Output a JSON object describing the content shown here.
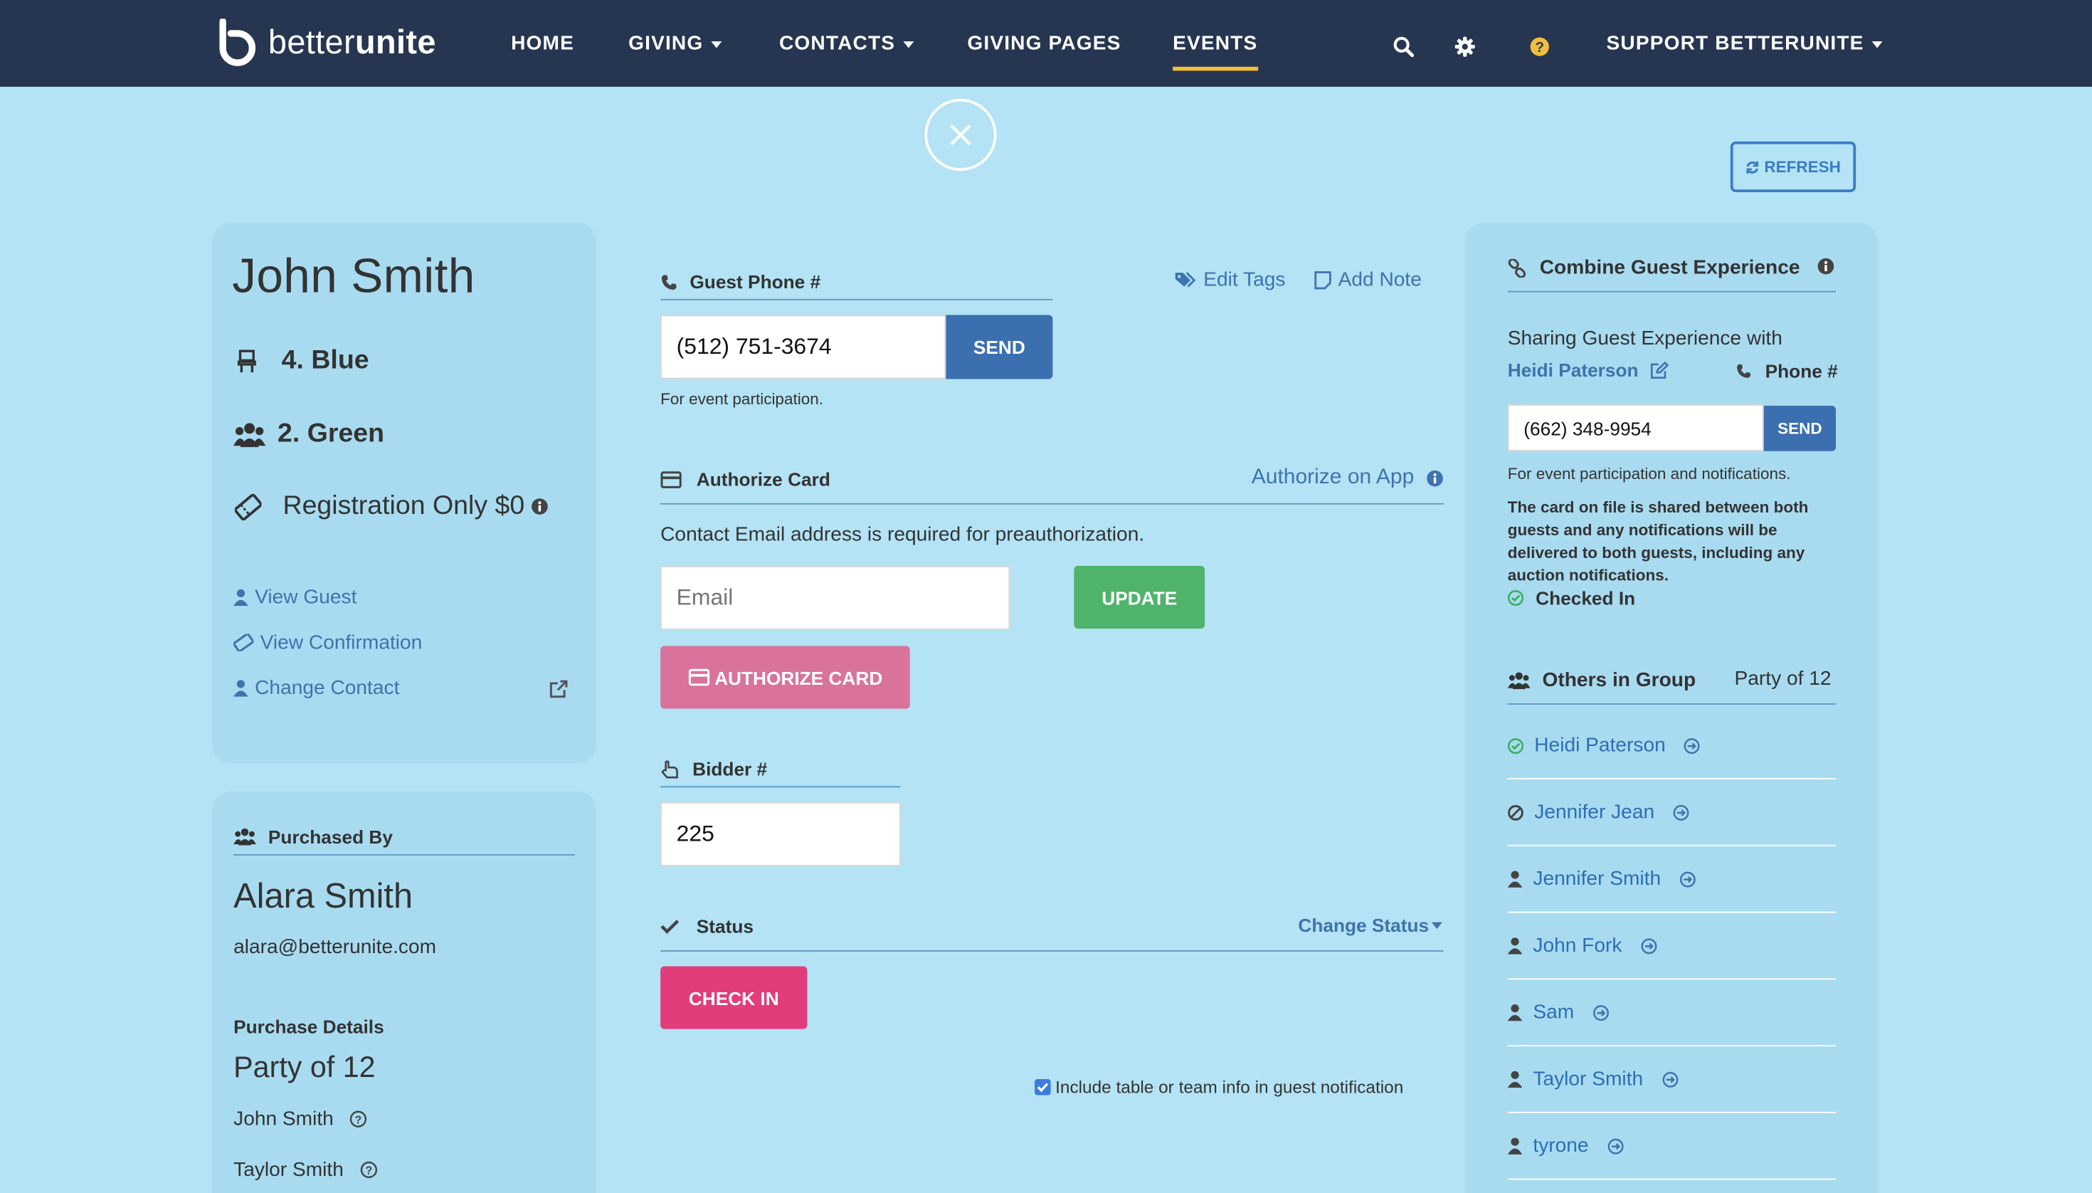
{
  "nav": {
    "logo_light": "better",
    "logo_bold": "unite",
    "items": [
      {
        "label": "HOME",
        "dropdown": false
      },
      {
        "label": "GIVING",
        "dropdown": true
      },
      {
        "label": "CONTACTS",
        "dropdown": true
      },
      {
        "label": "GIVING PAGES",
        "dropdown": false
      },
      {
        "label": "EVENTS",
        "dropdown": false,
        "active": true
      }
    ],
    "support_label": "SUPPORT BETTERUNITE"
  },
  "toolbar": {
    "refresh_label": "REFRESH"
  },
  "guest": {
    "name": "John Smith",
    "table": "4. Blue",
    "team": "2. Green",
    "ticket": "Registration Only $0",
    "links": {
      "view_guest": "View Guest",
      "view_confirmation": "View Confirmation",
      "change_contact": "Change Contact"
    }
  },
  "purchase": {
    "heading": "Purchased By",
    "buyer_name": "Alara Smith",
    "buyer_email": "alara@betterunite.com",
    "details_heading": "Purchase Details",
    "party": "Party of 12",
    "guests": [
      "John Smith",
      "Taylor Smith"
    ]
  },
  "phone": {
    "heading": "Guest Phone #",
    "value": "(512) 751-3674",
    "send_label": "SEND",
    "help": "For event participation."
  },
  "actions": {
    "edit_tags": "Edit Tags",
    "add_note": "Add Note"
  },
  "card": {
    "heading": "Authorize Card",
    "app_link": "Authorize on App",
    "notice": "Contact Email address is required for preauthorization.",
    "email_placeholder": "Email",
    "update_label": "UPDATE",
    "authorize_label": "AUTHORIZE CARD"
  },
  "bidder": {
    "heading": "Bidder #",
    "value": "225"
  },
  "status": {
    "heading": "Status",
    "change_label": "Change Status",
    "checkin_label": "CHECK IN",
    "include_label": "Include table or team info in guest notification",
    "include_checked": true
  },
  "combine": {
    "heading": "Combine Guest Experience",
    "sharing_label": "Sharing Guest Experience with",
    "partner": "Heidi Paterson",
    "phone_label": "Phone #",
    "phone_value": "(662) 348-9954",
    "send_label": "SEND",
    "help": "For event participation and notifications.",
    "note": "The card on file is shared between both guests and any notifications will be delivered to both guests, including any auction notifications.",
    "checked_in": "Checked In"
  },
  "group": {
    "heading": "Others in Group",
    "party": "Party of 12",
    "members": [
      {
        "name": "Heidi Paterson",
        "state": "checked"
      },
      {
        "name": "Jennifer Jean",
        "state": "blocked"
      },
      {
        "name": "Jennifer Smith",
        "state": "person"
      },
      {
        "name": "John Fork",
        "state": "person"
      },
      {
        "name": "Sam",
        "state": "person"
      },
      {
        "name": "Taylor Smith",
        "state": "person"
      },
      {
        "name": "tyrone",
        "state": "person"
      }
    ]
  },
  "colors": {
    "nav_bg": "#263550",
    "page_bg": "#b3e3f4",
    "panel_bg": "#a8dbf0",
    "primary": "#3b6fb0",
    "success": "#4fb36b",
    "pink": "#e03d7a",
    "pink_light": "#d9739c",
    "active_underline": "#f3bd3c"
  }
}
